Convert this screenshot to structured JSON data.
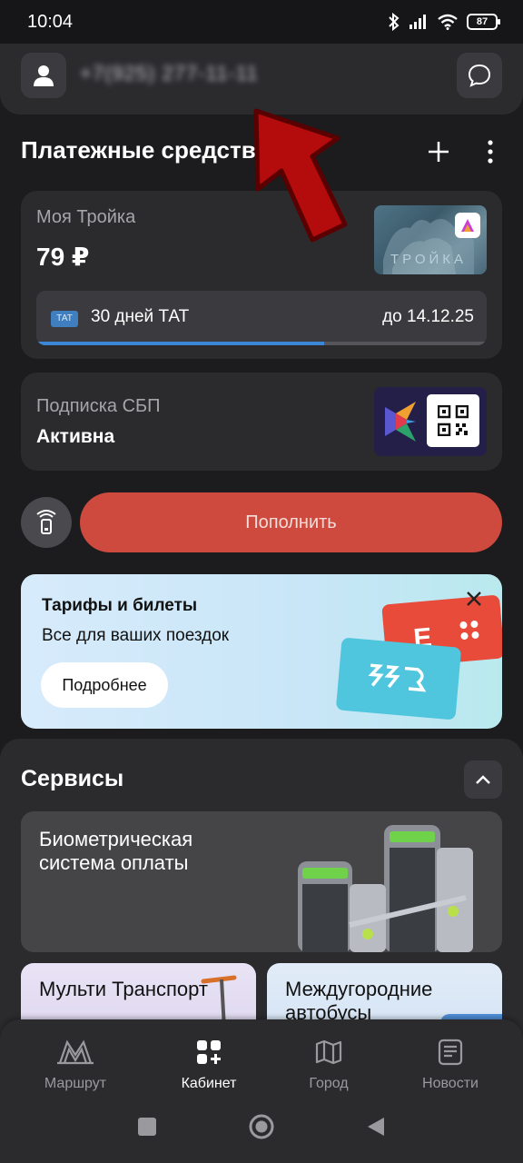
{
  "status_bar": {
    "time": "10:04",
    "battery": "87"
  },
  "profile": {
    "phone": "+7(925) 277-11-11"
  },
  "payment": {
    "title": "Платежные средства",
    "troika": {
      "label": "Моя Тройка",
      "balance": "79 ₽",
      "image_text": "ТРОЙКА",
      "ticket": {
        "tag": "ТАТ",
        "name": "30 дней ТАТ",
        "valid_until": "до 14.12.25",
        "progress_fraction": 0.64
      }
    },
    "sbp": {
      "label": "Подписка СБП",
      "status": "Активна"
    },
    "topup_label": "Пополнить"
  },
  "promo": {
    "title": "Тарифы и билеты",
    "subtitle": "Все для ваших поездок",
    "button": "Подробнее"
  },
  "services": {
    "title": "Сервисы",
    "biometric": "Биометрическая система оплаты",
    "multi_transport": "Мульти Транспорт",
    "intercity_buses": "Междугородние автобусы"
  },
  "nav": {
    "items": [
      {
        "label": "Маршрут",
        "icon": "metro-icon"
      },
      {
        "label": "Кабинет",
        "icon": "cabinet-icon"
      },
      {
        "label": "Город",
        "icon": "map-icon"
      },
      {
        "label": "Новости",
        "icon": "news-icon"
      }
    ],
    "active_index": 1
  },
  "colors": {
    "accent_red": "#cf4a3e",
    "progress_blue": "#3b86d6",
    "annotation_arrow": "#b40c0c"
  }
}
